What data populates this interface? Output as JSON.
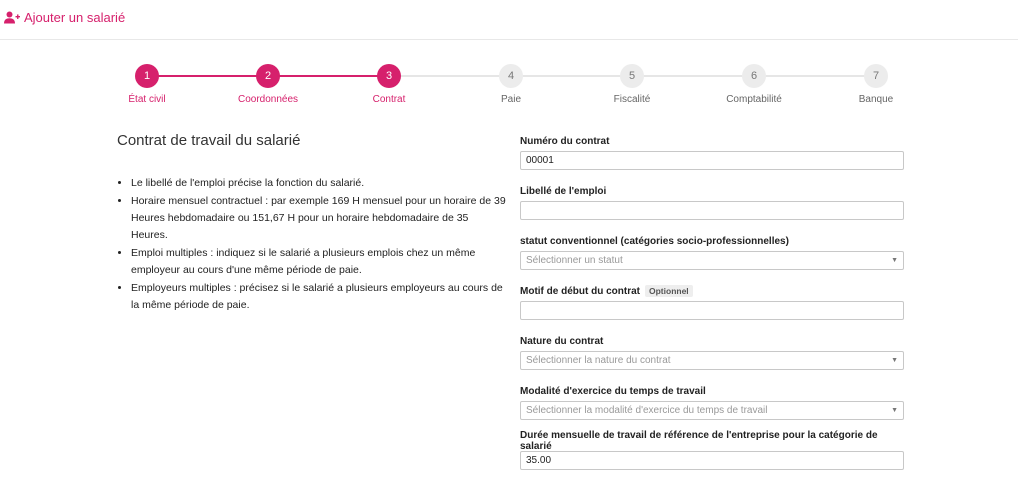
{
  "header": {
    "title": "Ajouter un salarié",
    "icon": "user-plus-icon"
  },
  "stepper": {
    "steps": [
      {
        "number": "1",
        "label": "État civil",
        "state": "completed"
      },
      {
        "number": "2",
        "label": "Coordonnées",
        "state": "completed"
      },
      {
        "number": "3",
        "label": "Contrat",
        "state": "current"
      },
      {
        "number": "4",
        "label": "Paie",
        "state": "upcoming"
      },
      {
        "number": "5",
        "label": "Fiscalité",
        "state": "upcoming"
      },
      {
        "number": "6",
        "label": "Comptabilité",
        "state": "upcoming"
      },
      {
        "number": "7",
        "label": "Banque",
        "state": "upcoming"
      }
    ]
  },
  "info": {
    "title": "Contrat de travail du salarié",
    "bullets": [
      "Le libellé de l'emploi précise la fonction du salarié.",
      "Horaire mensuel contractuel : par exemple 169 H mensuel pour un horaire de 39 Heures hebdomadaire ou 151,67 H pour un horaire hebdomadaire de 35 Heures.",
      "Emploi multiples : indiquez si le salarié a plusieurs emplois chez un même employeur au cours d'une même période de paie.",
      "Employeurs multiples : précisez si le salarié a plusieurs employeurs au cours de la même période de paie."
    ]
  },
  "form": {
    "numero_contrat": {
      "label": "Numéro du contrat",
      "value": "00001"
    },
    "libelle_emploi": {
      "label": "Libellé de l'emploi",
      "value": ""
    },
    "statut": {
      "label": "statut conventionnel (catégories socio-professionnelles)",
      "placeholder": "Sélectionner un statut"
    },
    "motif": {
      "label": "Motif de début du contrat",
      "badge": "Optionnel",
      "value": ""
    },
    "nature": {
      "label": "Nature du contrat",
      "placeholder": "Sélectionner la nature du contrat"
    },
    "modalite": {
      "label": "Modalité d'exercice du temps de travail",
      "placeholder": "Sélectionner la modalité d'exercice du temps de travail"
    },
    "duree": {
      "label": "Durée mensuelle de travail de référence de l'entreprise pour la catégorie de salarié",
      "value": "35.00"
    }
  },
  "colors": {
    "accent": "#d6206c",
    "inactive": "#ececec"
  }
}
